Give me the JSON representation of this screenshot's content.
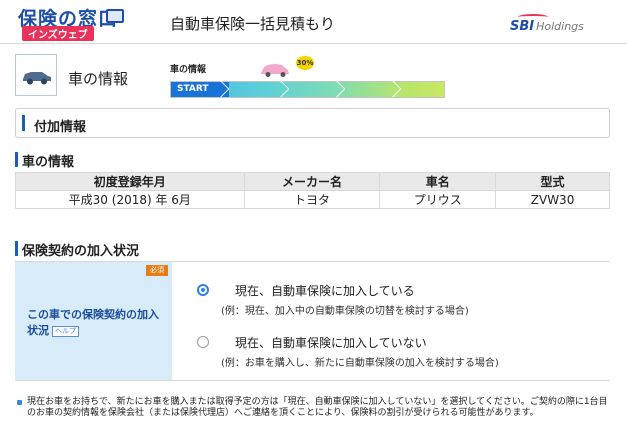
{
  "header": {
    "logo_main": "保険の窓口",
    "logo_sub": "インズウェブ",
    "title": "自動車保険一括見積もり",
    "brand_mark": "SBI",
    "brand_text": "Holdings"
  },
  "progress": {
    "current_step_label": "車の情報",
    "caption": "車の情報",
    "percent_badge": "30%",
    "start_label": "START",
    "fraction": 0.3
  },
  "section": {
    "title": "付加情報"
  },
  "car_info": {
    "heading": "車の情報",
    "columns": [
      "初度登録年月",
      "メーカー名",
      "車名",
      "型式"
    ],
    "row": [
      "平成30 (2018) 年 6月",
      "トヨタ",
      "プリウス",
      "ZVW30"
    ]
  },
  "insurance": {
    "heading": "保険契約の加入状況",
    "required_badge": "必須",
    "question": "この車での保険契約の加入状況",
    "help_label": "ヘルプ",
    "options": [
      {
        "label": "現在、自動車保険に加入している",
        "note": "(例：現在、加入中の自動車保険の切替を検討する場合)",
        "selected": true
      },
      {
        "label": "現在、自動車保険に加入していない",
        "note": "(例：お車を購入し、新たに自動車保険の加入を検討する場合)",
        "selected": false
      }
    ]
  },
  "footer_note": "現在お車をお持ちで、新たにお車を購入または取得予定の方は「現在、自動車保険に加入していない」を選択してください。ご契約の際に1台目のお車の契約情報を保険会社（または保険代理店）へご連絡を頂くことにより、保険料の割引が受けられる可能性があります。",
  "colors": {
    "accent_blue": "#1b5fb3",
    "start_blue": "#1773d6",
    "required_orange": "#e67d17",
    "panel_bg": "#d8ebf9"
  }
}
